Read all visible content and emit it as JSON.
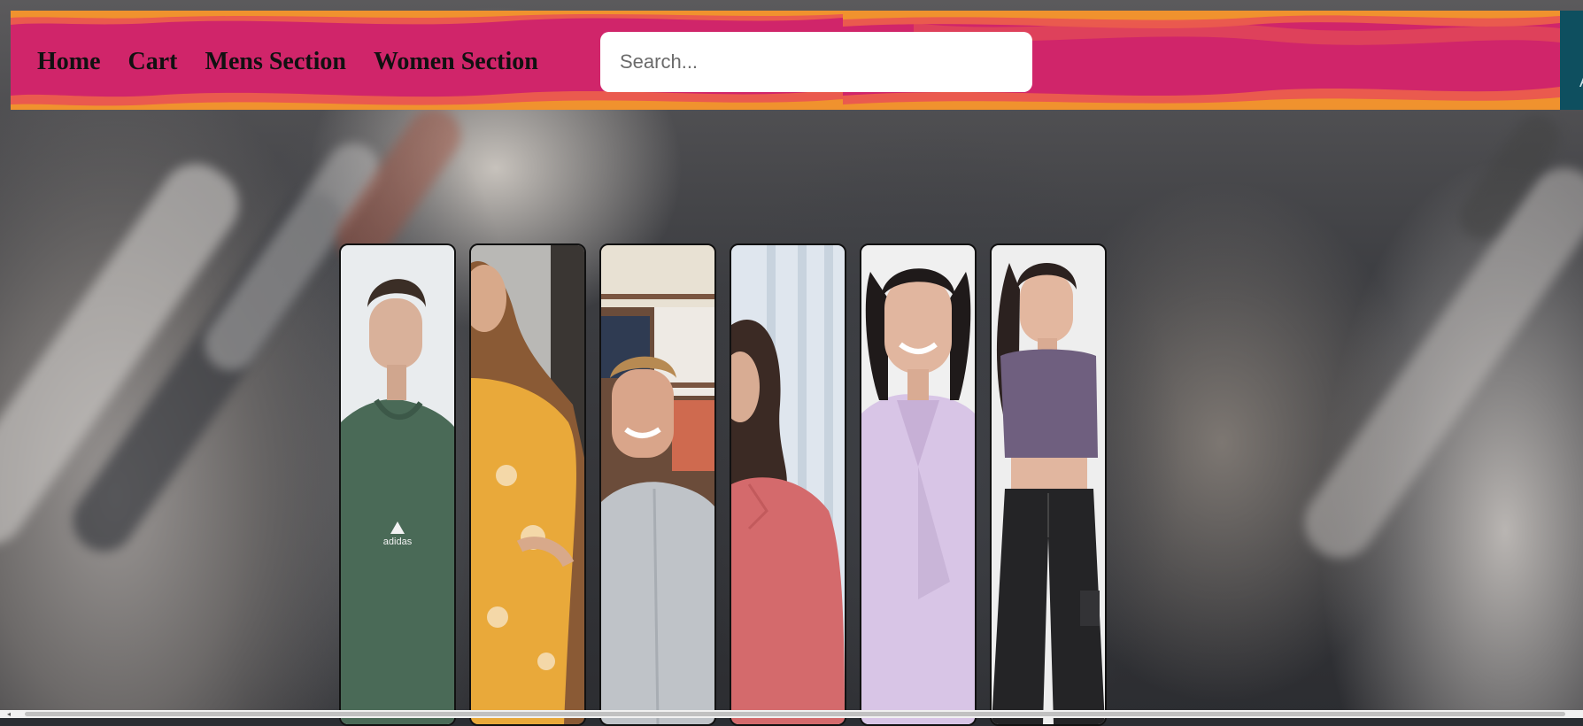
{
  "nav": {
    "items": [
      {
        "label": "Home"
      },
      {
        "label": "Cart"
      },
      {
        "label": "Mens Section"
      },
      {
        "label": "Women Section"
      }
    ]
  },
  "search": {
    "placeholder": "Search...",
    "value": ""
  },
  "products": [
    {
      "name": "green-hoodie-man",
      "accent": "#4a6a57",
      "brand_mark": "adidas"
    },
    {
      "name": "yellow-floral-dress-woman",
      "accent": "#e9a93a"
    },
    {
      "name": "grey-shirt-man",
      "accent": "#bfc3c8"
    },
    {
      "name": "pink-shirt-woman",
      "accent": "#d46a6c"
    },
    {
      "name": "lavender-top-woman",
      "accent": "#d8c5e6"
    },
    {
      "name": "purple-crop-top-woman",
      "accent": "#6f5f7f"
    }
  ],
  "colors": {
    "header_pink": "#d0256a",
    "header_coral": "#ea5a4e",
    "header_orange": "#f0922e",
    "right_panel": "#0e4f5f"
  }
}
